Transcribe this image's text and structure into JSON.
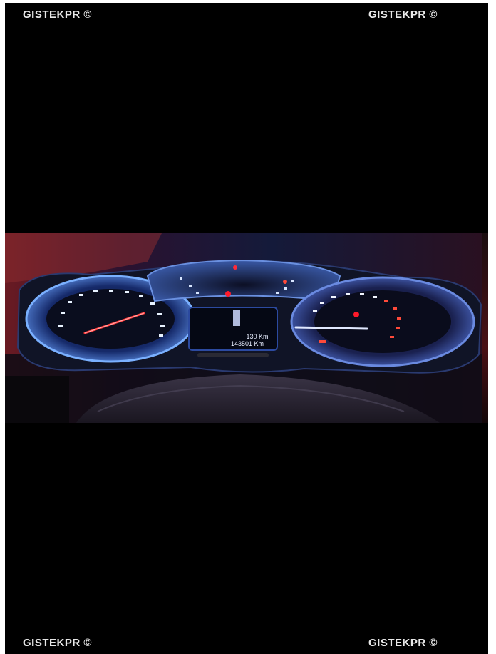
{
  "watermark": {
    "top_left": "GISTEKPR ©",
    "top_right": "GISTEKPR ©",
    "bottom_left": "GISTEKPR ©",
    "bottom_right": "GISTEKPR ©"
  },
  "dashboard": {
    "display_range": "130 Km",
    "odometer": "143501 Km"
  },
  "colors": {
    "background": "#000000",
    "gauge_glow": "#6ea8ff",
    "needle": "#ff3a3a",
    "warning_light": "#ff1a2a"
  }
}
